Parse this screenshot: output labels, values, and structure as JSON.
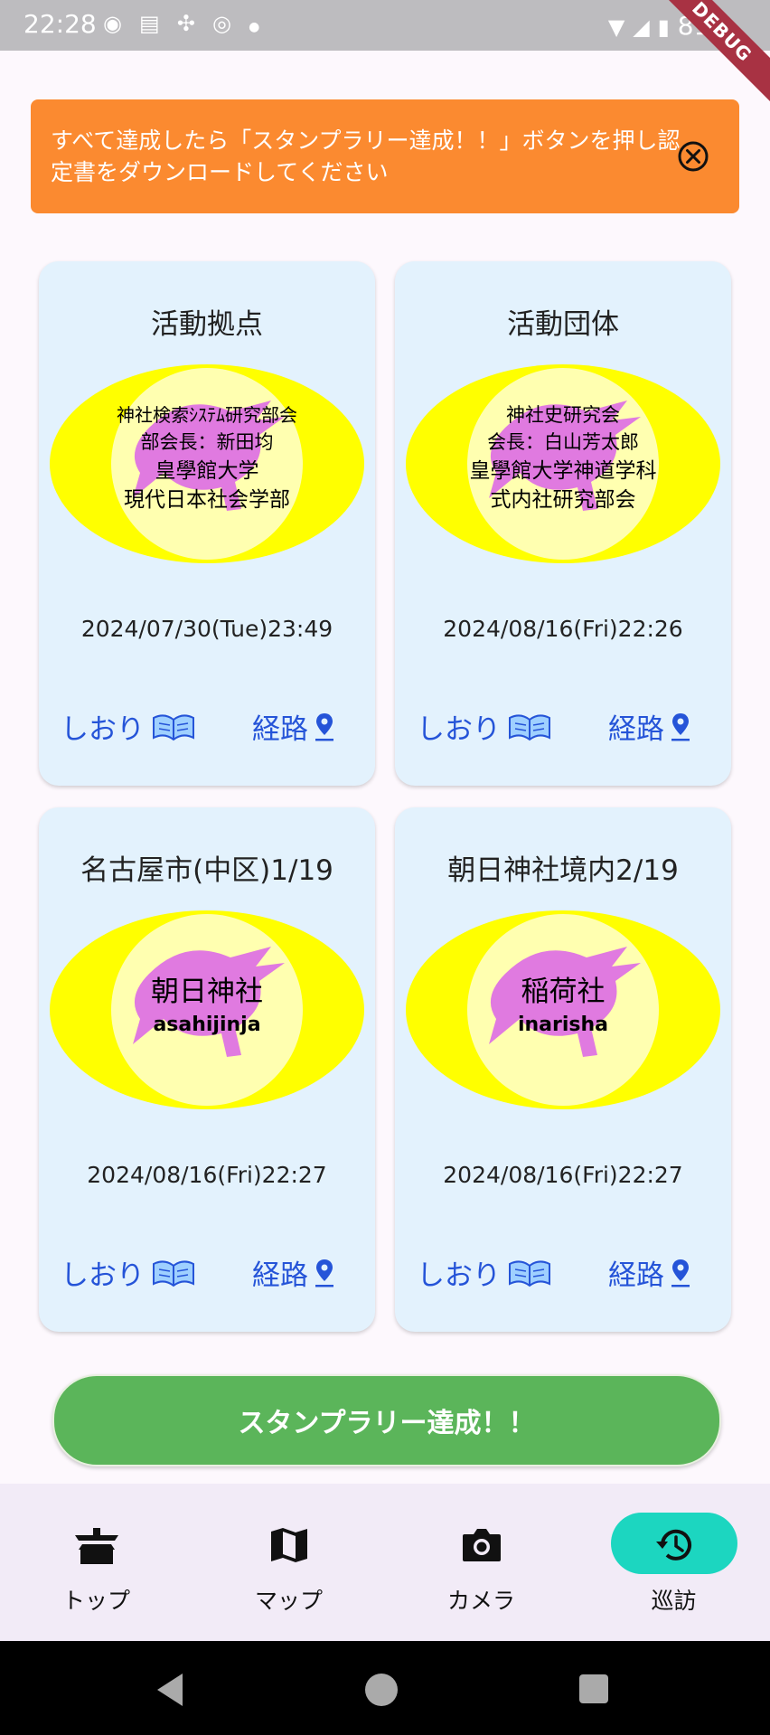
{
  "status_bar": {
    "time": "22:28",
    "battery": "81%",
    "icons": [
      "messenger-icon",
      "sim-icon",
      "slack-icon",
      "app-icon",
      "dot-icon"
    ],
    "debug_label": "DEBUG"
  },
  "banner": {
    "message": "すべて達成したら「スタンプラリー達成！！」ボタンを押し認定書をダウンロードしてください",
    "close_icon": "close-circle-icon",
    "color": "#fb8a30"
  },
  "cards": [
    {
      "title": "活動拠点",
      "stamp_lines": [
        "神社検索ｼｽﾃﾑ研究部会",
        "部会長：新田均",
        "皇學館大学",
        "現代日本社会学部"
      ],
      "date": "2024/07/30(Tue)23:49",
      "bookmark_label": "しおり",
      "route_label": "経路"
    },
    {
      "title": "活動団体",
      "stamp_lines": [
        "神社史研究会",
        "会長：白山芳太郎",
        "皇學館大学神道学科",
        "式内社研究部会"
      ],
      "date": "2024/08/16(Fri)22:26",
      "bookmark_label": "しおり",
      "route_label": "経路"
    },
    {
      "title": "名古屋市(中区)1/19",
      "stamp_name": "朝日神社",
      "stamp_romaji": "asahijinja",
      "date": "2024/08/16(Fri)22:27",
      "bookmark_label": "しおり",
      "route_label": "経路"
    },
    {
      "title": "朝日神社境内2/19",
      "stamp_name": "稲荷社",
      "stamp_romaji": "inarisha",
      "date": "2024/08/16(Fri)22:27",
      "bookmark_label": "しおり",
      "route_label": "経路"
    }
  ],
  "achieve_button": {
    "label": "スタンプラリー達成！！",
    "color": "#5bb55a"
  },
  "bottom_nav": {
    "items": [
      {
        "label": "トップ",
        "icon": "shrine-icon"
      },
      {
        "label": "マップ",
        "icon": "map-icon"
      },
      {
        "label": "カメラ",
        "icon": "camera-icon"
      },
      {
        "label": "巡訪",
        "icon": "history-icon",
        "active": true
      }
    ],
    "active_color": "#1cd6c0"
  },
  "colors": {
    "card_bg": "#e3f2fd",
    "link": "#2554d8",
    "stamp_outer": "#ffff00",
    "stamp_inner": "#ffffb0",
    "bird": "#e07ae0"
  }
}
